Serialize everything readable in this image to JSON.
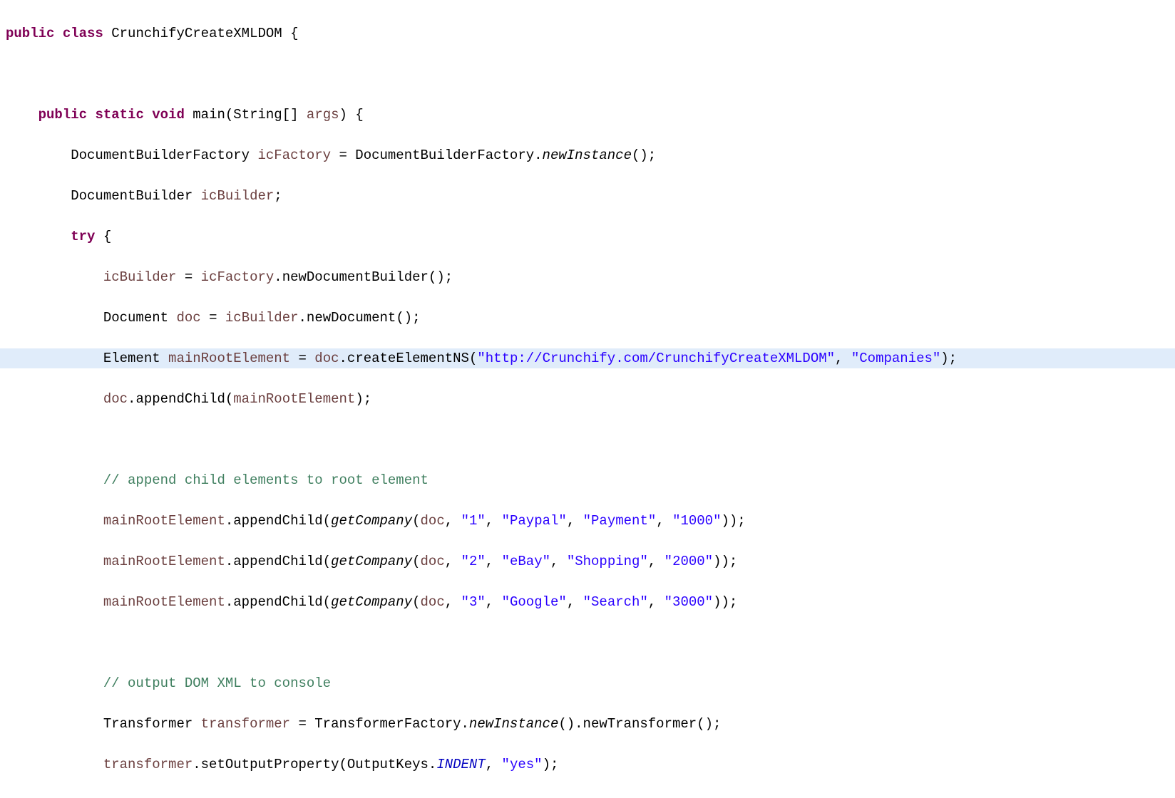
{
  "code": {
    "line1": {
      "kw_public": "public",
      "kw_class": "class",
      "classname": "CrunchifyCreateXMLDOM",
      "brace": " {"
    },
    "line2": "",
    "line3": {
      "kw_public": "public",
      "kw_static": "static",
      "kw_void": "void",
      "method": "main",
      "params": "(String[] ",
      "argname": "args",
      "close": ") {"
    },
    "line4": {
      "type": "DocumentBuilderFactory ",
      "var": "icFactory",
      "eq": " = DocumentBuilderFactory.",
      "call": "newInstance",
      "end": "();"
    },
    "line5": {
      "type": "DocumentBuilder ",
      "var": "icBuilder",
      "end": ";"
    },
    "line6": {
      "kw_try": "try",
      "brace": " {"
    },
    "line7": {
      "var": "icBuilder",
      "eq": " = ",
      "var2": "icFactory",
      "call": ".newDocumentBuilder();"
    },
    "line8": {
      "type": "Document ",
      "var": "doc",
      "eq": " = ",
      "var2": "icBuilder",
      "call": ".newDocument();"
    },
    "line9": {
      "type": "Element ",
      "var": "mainRootElement",
      "eq": " = ",
      "var2": "doc",
      "call": ".createElementNS(",
      "str1": "\"http://Crunchify.com/CrunchifyCreateXMLDOM\"",
      "comma": ", ",
      "str2": "\"Companies\"",
      "end": ");"
    },
    "line10": {
      "var": "doc",
      "call": ".appendChild(",
      "var2": "mainRootElement",
      "end": ");"
    },
    "line11": "",
    "line12": "// append child elements to root element",
    "line13": {
      "var": "mainRootElement",
      "call": ".appendChild(",
      "fn": "getCompany",
      "open": "(",
      "var2": "doc",
      "c1": ", ",
      "s1": "\"1\"",
      "c2": ", ",
      "s2": "\"Paypal\"",
      "c3": ", ",
      "s3": "\"Payment\"",
      "c4": ", ",
      "s4": "\"1000\"",
      "end": "));"
    },
    "line14": {
      "var": "mainRootElement",
      "call": ".appendChild(",
      "fn": "getCompany",
      "open": "(",
      "var2": "doc",
      "c1": ", ",
      "s1": "\"2\"",
      "c2": ", ",
      "s2": "\"eBay\"",
      "c3": ", ",
      "s3": "\"Shopping\"",
      "c4": ", ",
      "s4": "\"2000\"",
      "end": "));"
    },
    "line15": {
      "var": "mainRootElement",
      "call": ".appendChild(",
      "fn": "getCompany",
      "open": "(",
      "var2": "doc",
      "c1": ", ",
      "s1": "\"3\"",
      "c2": ", ",
      "s2": "\"Google\"",
      "c3": ", ",
      "s3": "\"Search\"",
      "c4": ", ",
      "s4": "\"3000\"",
      "end": "));"
    },
    "line16": "",
    "line17": "// output DOM XML to console",
    "line18": {
      "type": "Transformer ",
      "var": "transformer",
      "eq": " = TransformerFactory.",
      "call1": "newInstance",
      "mid": "().newTransformer();"
    },
    "line19": {
      "var": "transformer",
      "call": ".setOutputProperty(OutputKeys.",
      "field": "INDENT",
      "c": ", ",
      "s": "\"yes\"",
      "end": ");"
    }
  }
}
